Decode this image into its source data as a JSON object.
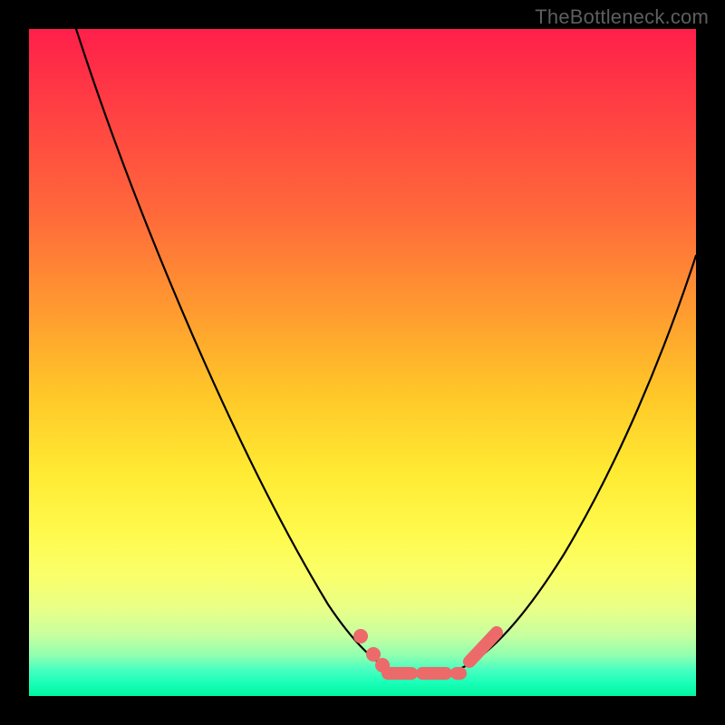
{
  "watermark": "TheBottleneck.com",
  "colors": {
    "background": "#000000",
    "gradient_top": "#ff1f4a",
    "gradient_mid": "#ffe932",
    "gradient_bottom": "#00f5a0",
    "curve": "#000000",
    "markers": "#ec6a6a"
  },
  "chart_data": {
    "type": "line",
    "title": "",
    "xlabel": "",
    "ylabel": "",
    "xlim": [
      0,
      100
    ],
    "ylim": [
      0,
      100
    ],
    "grid": false,
    "note": "Bottleneck-style V-curve. No axis ticks or numeric labels are rendered in the image; x/y values below are estimated from curve geometry (0–100 each axis, y=0 at bottom).",
    "series": [
      {
        "name": "left-branch",
        "x": [
          7,
          10,
          14,
          18,
          22,
          26,
          30,
          34,
          38,
          42,
          46,
          48,
          50,
          52,
          54
        ],
        "y": [
          100,
          91,
          81,
          71,
          61,
          52,
          43,
          35,
          27,
          20,
          13,
          10,
          7,
          5,
          4
        ]
      },
      {
        "name": "valley-flat",
        "x": [
          54,
          56,
          58,
          60,
          62,
          64
        ],
        "y": [
          4,
          3.5,
          3.3,
          3.3,
          3.5,
          4
        ]
      },
      {
        "name": "right-branch",
        "x": [
          64,
          67,
          70,
          74,
          78,
          82,
          86,
          90,
          94,
          98,
          100
        ],
        "y": [
          4,
          6,
          9,
          14,
          20,
          27,
          35,
          44,
          53,
          62,
          67
        ]
      }
    ],
    "markers": [
      {
        "name": "left-dot-upper",
        "x": 50,
        "y": 9
      },
      {
        "name": "left-dot-mid",
        "x": 52,
        "y": 6
      },
      {
        "name": "left-dot-lower",
        "x": 53,
        "y": 4.5
      },
      {
        "name": "right-dot-lower",
        "x": 67,
        "y": 7
      },
      {
        "name": "right-dot-upper",
        "x": 70,
        "y": 11
      }
    ],
    "valley_segment": {
      "x_start": 54,
      "x_end": 64,
      "y": 3.3
    }
  }
}
